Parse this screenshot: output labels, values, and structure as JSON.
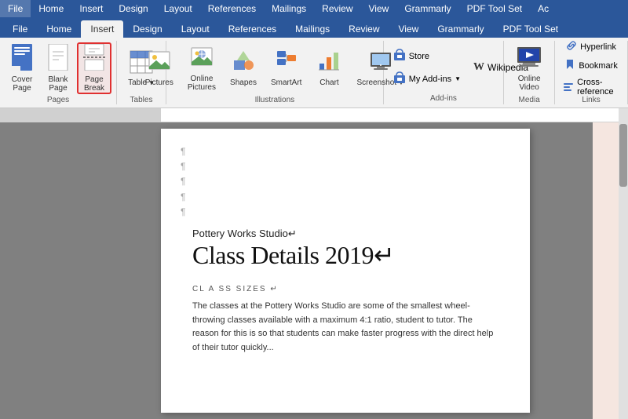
{
  "menu": {
    "items": [
      "File",
      "Home",
      "Insert",
      "Design",
      "Layout",
      "References",
      "Mailings",
      "Review",
      "View",
      "Grammarly",
      "PDF Tool Set",
      "Ac"
    ]
  },
  "ribbon": {
    "active_tab": "Insert",
    "groups": {
      "pages": {
        "label": "Pages",
        "buttons": [
          {
            "id": "cover-page",
            "label": "Cover\nPage",
            "icon": "📄"
          },
          {
            "id": "blank-page",
            "label": "Blank\nPage",
            "icon": "📋"
          },
          {
            "id": "page-break",
            "label": "Page\nBreak",
            "icon": "📑",
            "highlighted": true
          }
        ]
      },
      "tables": {
        "label": "Tables",
        "buttons": [
          {
            "id": "table",
            "label": "Table",
            "icon": "⊞"
          }
        ]
      },
      "illustrations": {
        "label": "Illustrations",
        "buttons": [
          {
            "id": "pictures",
            "label": "Pictures",
            "icon": "🖼"
          },
          {
            "id": "online-pictures",
            "label": "Online\nPictures",
            "icon": "🌐"
          },
          {
            "id": "shapes",
            "label": "Shapes",
            "icon": "◻"
          },
          {
            "id": "smartart",
            "label": "SmartArt",
            "icon": "📊"
          },
          {
            "id": "chart",
            "label": "Chart",
            "icon": "📈"
          },
          {
            "id": "screenshot",
            "label": "Screenshot",
            "icon": "🖥"
          }
        ]
      },
      "addins": {
        "label": "Add-ins",
        "store_label": "Store",
        "myadd_label": "My Add-ins",
        "wikipedia_label": "Wikipedia"
      },
      "media": {
        "label": "Media",
        "buttons": [
          {
            "id": "online-video",
            "label": "Online\nVideo",
            "icon": "▶"
          }
        ]
      },
      "links": {
        "label": "Links",
        "items": [
          {
            "id": "hyperlink",
            "label": "Hyperlink"
          },
          {
            "id": "bookmark",
            "label": "Bookmark"
          },
          {
            "id": "cross-reference",
            "label": "Cross-reference"
          }
        ]
      }
    }
  },
  "document": {
    "subtitle": "Pottery Works Studio↵",
    "title": "Class Details 2019↵",
    "section_label": "CL A SS SIZES ↵",
    "body": "The classes at the Pottery Works Studio are some of the smallest wheel-throwing classes available with a maximum 4:1 ratio, student to tutor. The reason for this is so that students can make faster progress with the direct help of their tutor quickly..."
  }
}
